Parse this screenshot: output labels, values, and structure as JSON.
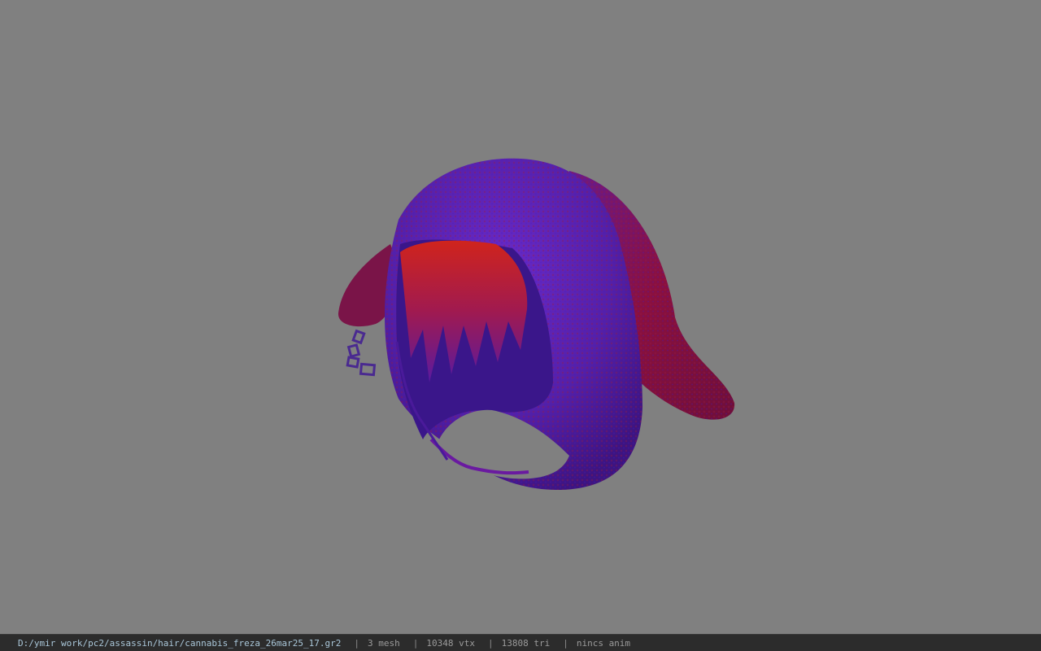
{
  "viewer": {
    "background_color": "#808080",
    "model": {
      "description_icon": "hooded-hair-model",
      "colors": {
        "hood_purple": "#5a1fb0",
        "hood_red": "#8a1030",
        "hair_red": "#c8202a",
        "chain": "#4a2a90"
      }
    }
  },
  "statusbar": {
    "file_path": "D:/ymir work/pc2/assassin/hair/cannabis_freza_26mar25_17.gr2",
    "separator": "|",
    "mesh_count": "3 mesh",
    "vertex_count": "10348 vtx",
    "triangle_count": "13808 tri",
    "anim_status": "nincs anim"
  }
}
